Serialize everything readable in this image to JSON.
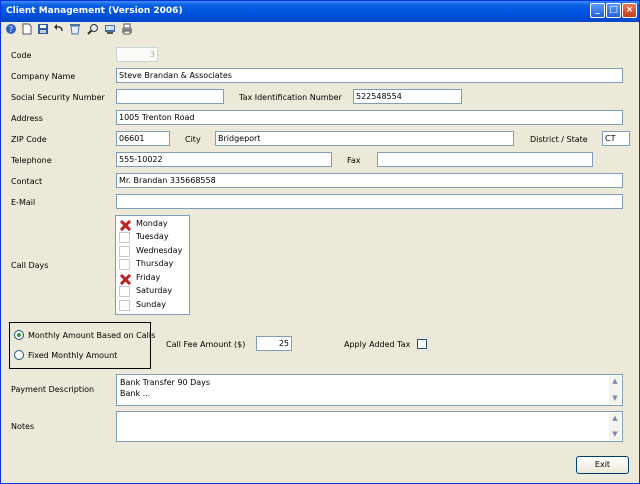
{
  "window": {
    "title": "Client Management (Version 2006)",
    "buttons": {
      "minimize": "_",
      "maximize": "□",
      "close": "×"
    }
  },
  "toolbar": [
    "help-icon",
    "new-icon",
    "save-icon",
    "undo-icon",
    "delete-icon",
    "search-icon",
    "print-preview-icon",
    "print-icon"
  ],
  "form": {
    "code": {
      "label": "Code",
      "value": "3"
    },
    "company_name": {
      "label": "Company Name",
      "value": "Steve Brandan & Associates"
    },
    "ssn": {
      "label": "Social Security Number",
      "value": ""
    },
    "tax_id": {
      "label": "Tax Identification Number",
      "value": "522548554"
    },
    "address": {
      "label": "Address",
      "value": "1005 Trenton Road"
    },
    "zip": {
      "label": "ZIP Code",
      "value": "06601"
    },
    "city": {
      "label": "City",
      "value": "Bridgeport"
    },
    "district": {
      "label": "District / State",
      "value": "CT"
    },
    "telephone": {
      "label": "Telephone",
      "value": "555-10022"
    },
    "fax": {
      "label": "Fax",
      "value": ""
    },
    "contact": {
      "label": "Contact",
      "value": "Mr. Brandan 335668558"
    },
    "email": {
      "label": "E-Mail",
      "value": ""
    },
    "call_days": {
      "label": "Call Days",
      "days": [
        {
          "name": "Monday",
          "checked": true
        },
        {
          "name": "Tuesday",
          "checked": false
        },
        {
          "name": "Wednesday",
          "checked": false
        },
        {
          "name": "Thursday",
          "checked": false
        },
        {
          "name": "Friday",
          "checked": true
        },
        {
          "name": "Saturday",
          "checked": false
        },
        {
          "name": "Sunday",
          "checked": false
        }
      ]
    },
    "plan": {
      "options": [
        "Monthly Amount Based on Calls",
        "Fixed Monthly Amount"
      ],
      "selected": 0
    },
    "call_fee": {
      "label": "Call Fee Amount ($)",
      "value": "25"
    },
    "apply_tax": {
      "label": "Apply Added Tax",
      "checked": false
    },
    "payment": {
      "label": "Payment Description",
      "lines": [
        "Bank Transfer 90 Days",
        "Bank ..."
      ]
    },
    "notes": {
      "label": "Notes",
      "value": ""
    }
  },
  "exit_label": "Exit"
}
